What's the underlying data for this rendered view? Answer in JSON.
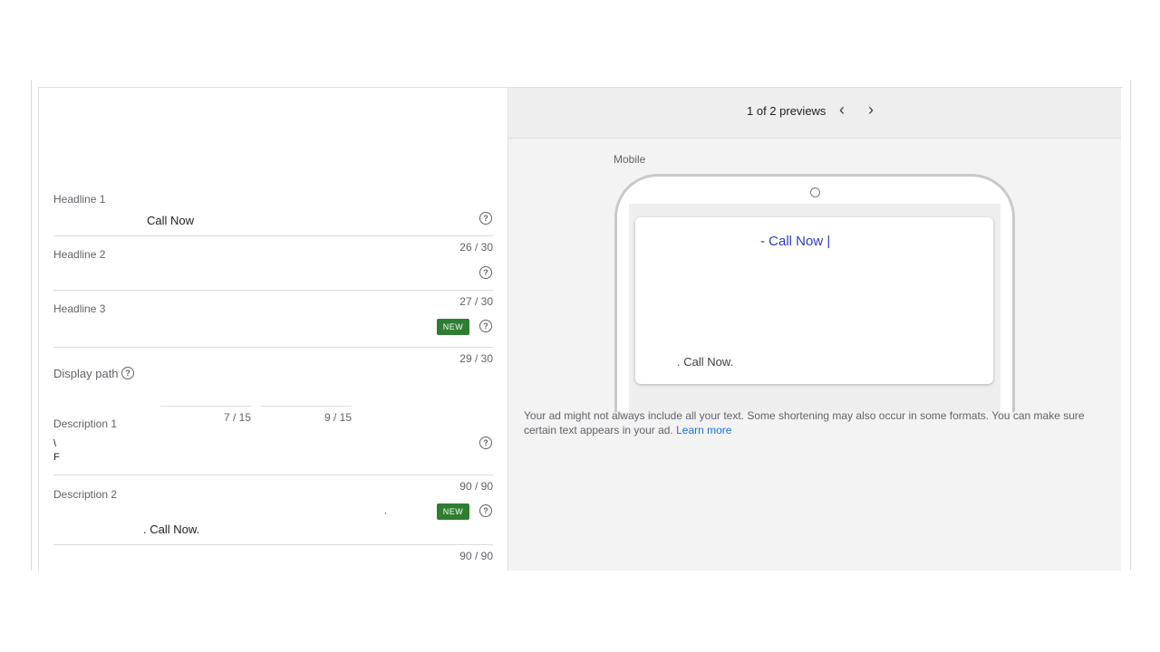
{
  "form": {
    "headline1": {
      "label": "Headline 1",
      "value": "Call Now",
      "counter": "26 / 30"
    },
    "headline2": {
      "label": "Headline 2",
      "counter": "27 / 30"
    },
    "headline3": {
      "label": "Headline 3",
      "counter": "29 / 30",
      "badge": "NEW"
    },
    "display_path": {
      "label": "Display path",
      "path1_counter": "7 / 15",
      "path2_counter": "9 / 15"
    },
    "description1": {
      "label": "Description 1",
      "value_line1": "\\",
      "value_line2": "F",
      "counter": "90 / 90"
    },
    "description2": {
      "label": "Description 2",
      "value": ". Call Now.",
      "stray": ",",
      "counter": "90 / 90",
      "badge": "NEW"
    }
  },
  "preview": {
    "count_text": "1 of 2 previews",
    "prev_icon": "chevron-left-icon",
    "next_icon": "chevron-right-icon",
    "device_label": "Mobile",
    "ad_headline": "- Call Now |",
    "ad_description": ". Call Now.",
    "note_text": "Your ad might not always include all your text. Some shortening may also occur in some formats. You can make sure certain text appears in your ad.",
    "learn_more": "Learn more"
  },
  "colors": {
    "badge_green": "#2e7d32",
    "headline_blue": "#2a3fbf",
    "link_blue": "#1a73e8"
  }
}
